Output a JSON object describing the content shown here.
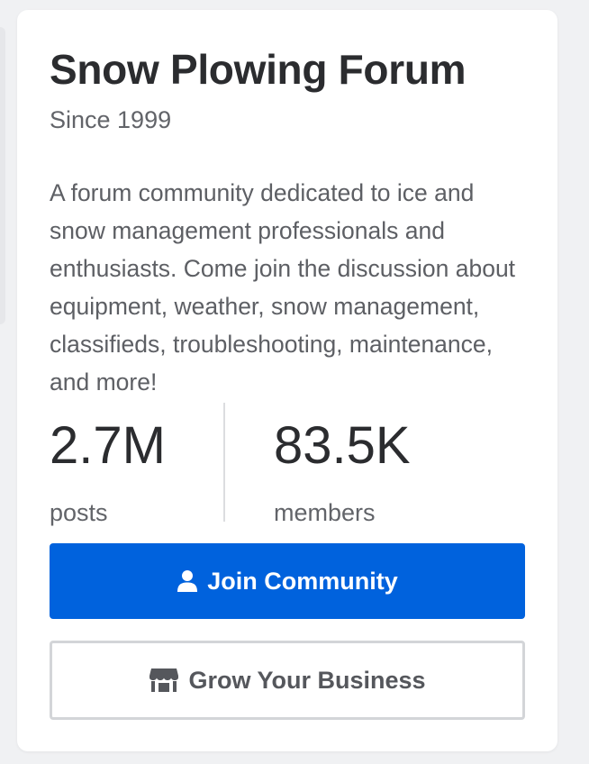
{
  "forum": {
    "title": "Snow Plowing Forum",
    "since": "Since 1999",
    "description": "A forum community dedicated to ice and snow management professionals and enthusiasts. Come join the discussion about equipment, weather, snow management, classifieds, troubleshooting, maintenance, and more!"
  },
  "stats": {
    "posts": {
      "value": "2.7M",
      "label": "posts"
    },
    "members": {
      "value": "83.5K",
      "label": "members"
    }
  },
  "buttons": {
    "join": {
      "label": "Join Community",
      "icon": "user-icon"
    },
    "grow": {
      "label": "Grow Your Business",
      "icon": "storefront-icon"
    }
  },
  "colors": {
    "primary": "#0062dd",
    "text_dark": "#2b2c2f",
    "text_muted": "#626469"
  }
}
